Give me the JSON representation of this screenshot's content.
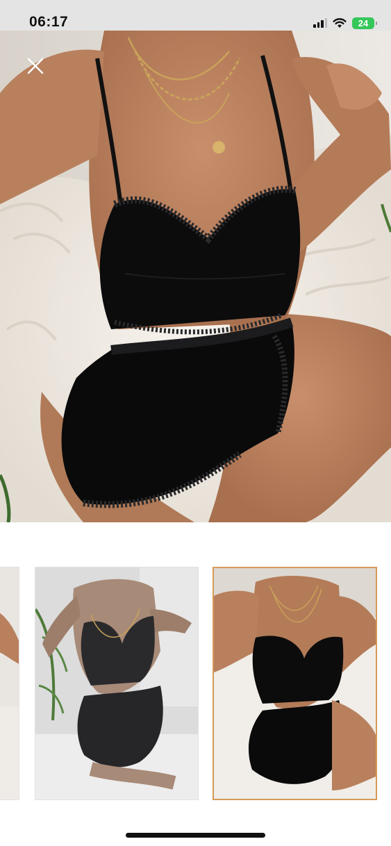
{
  "status_bar": {
    "time": "06:17",
    "battery": "24",
    "icons": [
      "signal-icon",
      "wifi-icon",
      "battery-charging-icon"
    ]
  },
  "viewer": {
    "close_icon": "close-icon",
    "main_image": "product-photo-black-lace-cami-shorts-set",
    "selected_thumbnail": 2
  },
  "thumbnails": [
    {
      "name": "product-photo-partial"
    },
    {
      "name": "product-photo-grey-set"
    },
    {
      "name": "product-photo-black-set"
    }
  ],
  "colors": {
    "accent_selected_border": "#d69a57",
    "battery": "#34c759"
  }
}
